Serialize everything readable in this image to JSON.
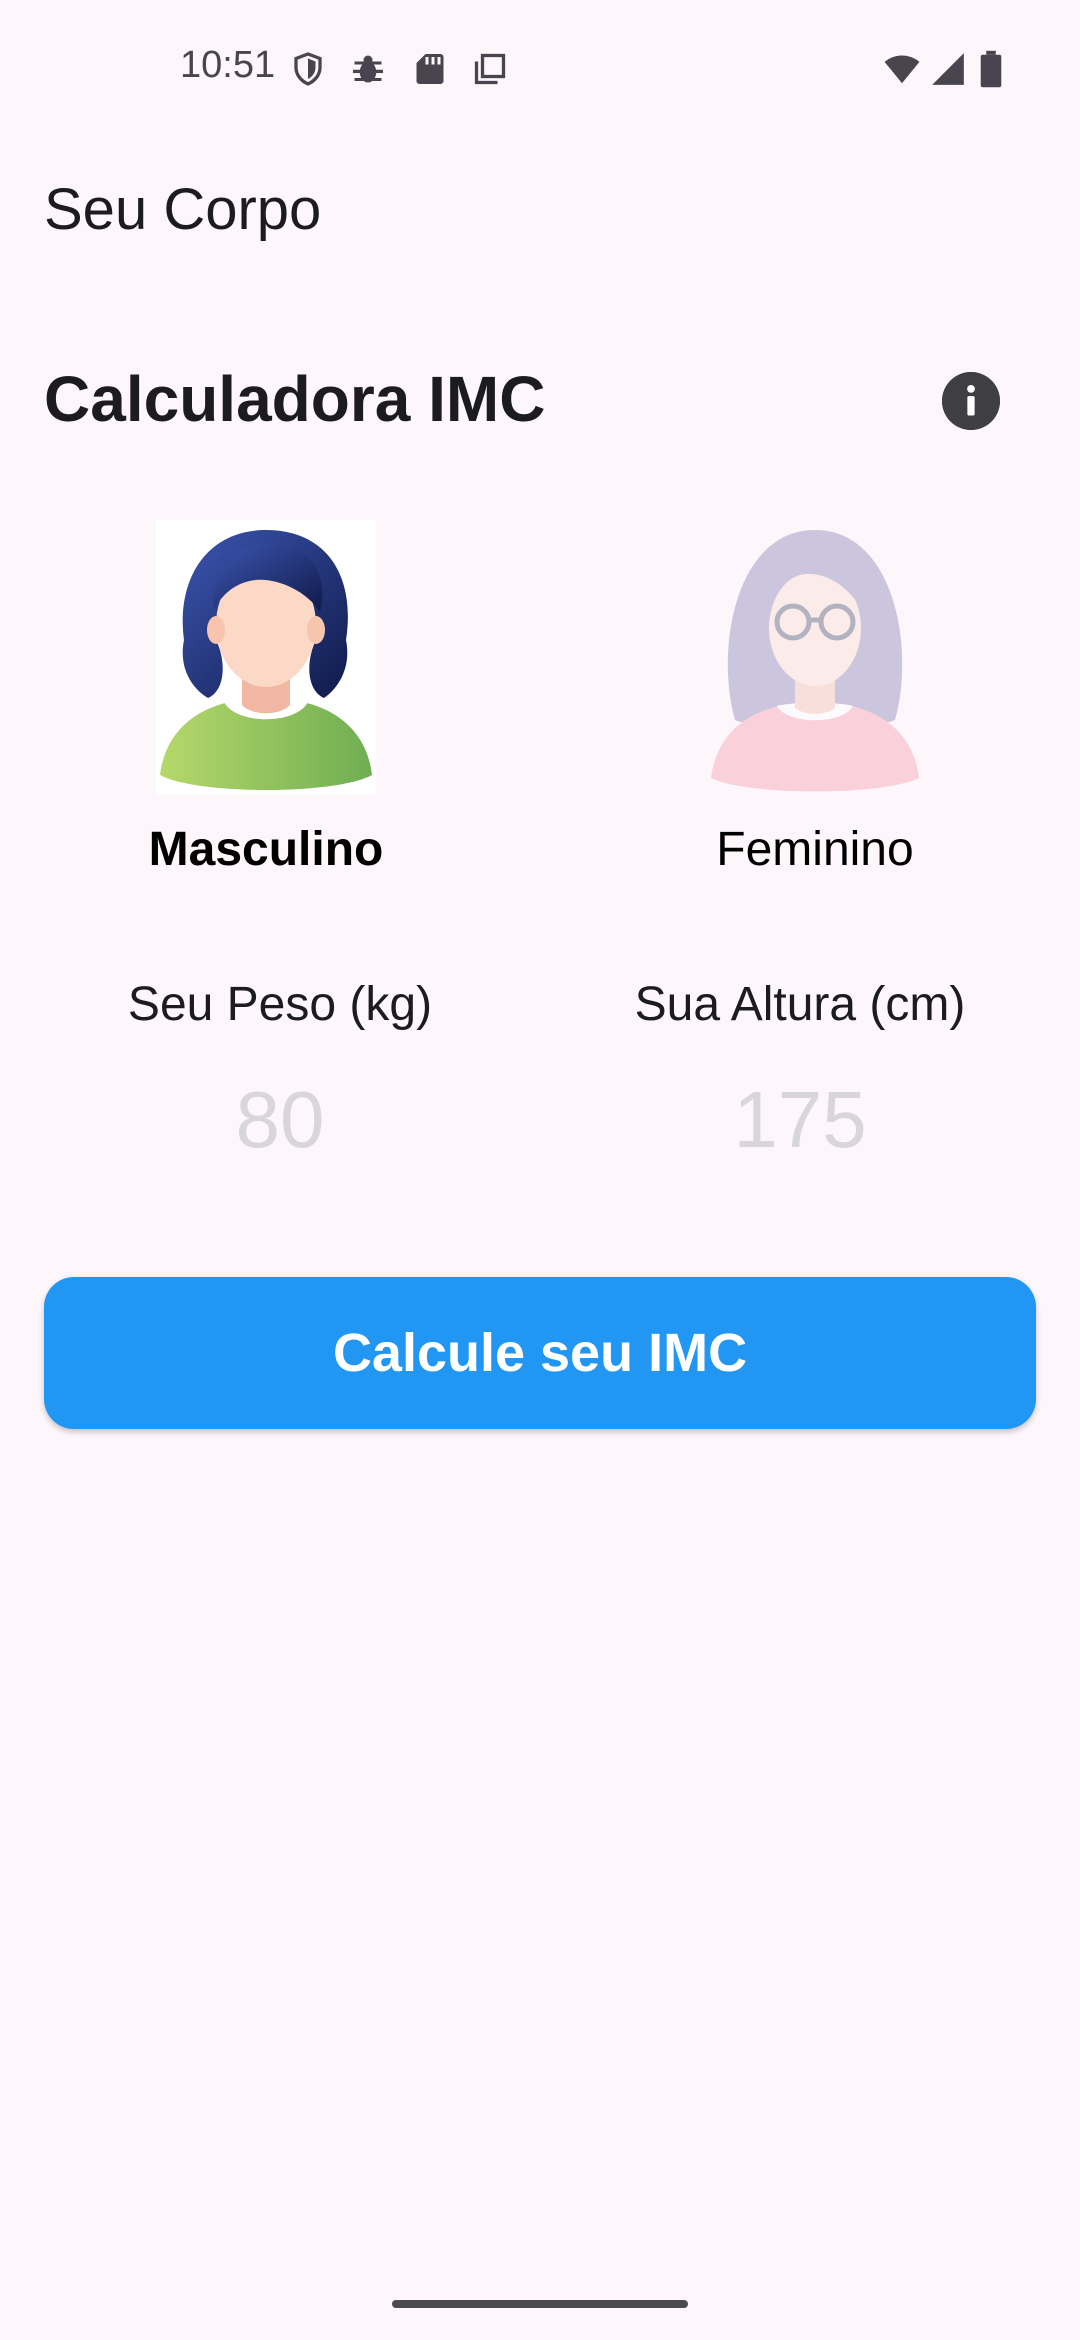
{
  "status_bar": {
    "time": "10:51",
    "left_icons": [
      "shield-icon",
      "bug-icon",
      "sd-card-icon",
      "copy-icon"
    ],
    "right_icons": [
      "wifi-icon",
      "cell-signal-icon",
      "battery-icon"
    ]
  },
  "app_bar": {
    "title": "Seu Corpo"
  },
  "calculator": {
    "title": "Calculadora IMC",
    "info_icon": "info-icon"
  },
  "gender": {
    "male_label": "Masculino",
    "female_label": "Feminino",
    "selected": "Masculino"
  },
  "weight": {
    "label": "Seu Peso (kg)",
    "placeholder": "80",
    "value": ""
  },
  "height": {
    "label": "Sua Altura (cm)",
    "placeholder": "175",
    "value": ""
  },
  "action": {
    "button_label": "Calcule seu IMC"
  },
  "colors": {
    "background": "#fdf7fc",
    "primary_button": "#2196f3",
    "info_button": "#3f3e43"
  }
}
